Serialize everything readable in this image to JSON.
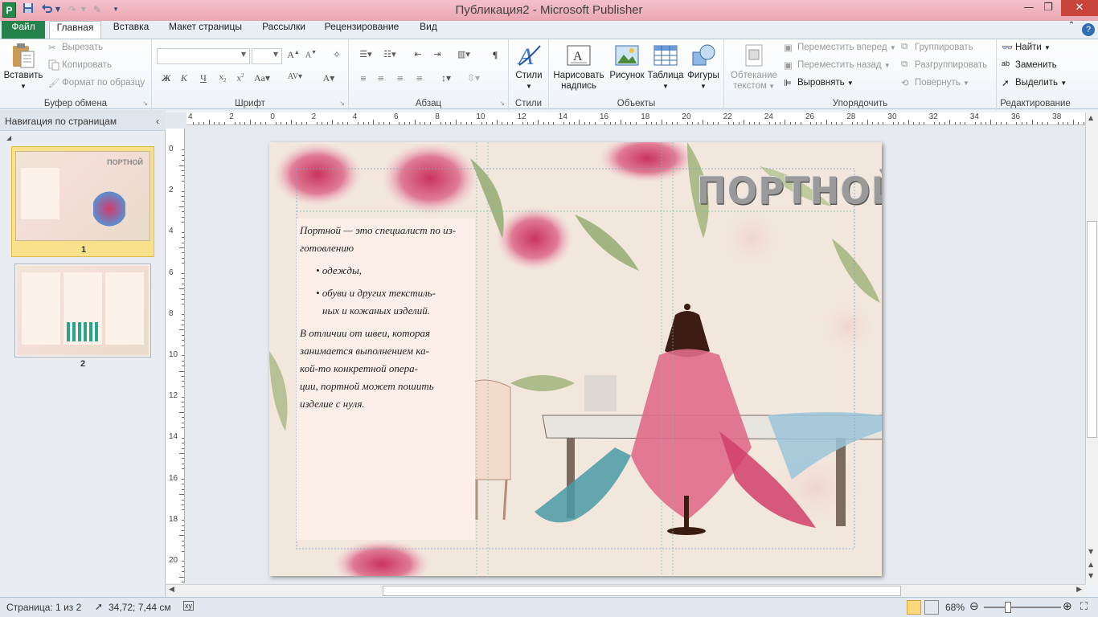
{
  "app": {
    "title": "Публикация2  -  Microsoft Publisher",
    "icon_letter": "P"
  },
  "quick_access": [
    "save-icon",
    "undo-icon",
    "redo-icon",
    "format-painter-icon",
    "customize-icon"
  ],
  "tabs": {
    "file": "Файл",
    "items": [
      "Главная",
      "Вставка",
      "Макет страницы",
      "Рассылки",
      "Рецензирование",
      "Вид"
    ]
  },
  "ribbon": {
    "clipboard": {
      "label": "Буфер обмена",
      "paste": "Вставить",
      "cut": "Вырезать",
      "copy": "Копировать",
      "format_painter": "Формат по образцу"
    },
    "font": {
      "label": "Шрифт"
    },
    "paragraph": {
      "label": "Абзац"
    },
    "styles": {
      "label": "Стили",
      "button": "Стили"
    },
    "objects": {
      "label": "Объекты",
      "draw_textbox": "Нарисовать надпись",
      "picture": "Рисунок",
      "table": "Таблица",
      "shapes": "Фигуры"
    },
    "arrange": {
      "label": "Упорядочить",
      "wrap_text": "Обтекание текстом",
      "bring_forward": "Переместить вперед",
      "send_backward": "Переместить назад",
      "align": "Выровнять",
      "group": "Группировать",
      "ungroup": "Разгруппировать",
      "rotate": "Повернуть"
    },
    "editing": {
      "label": "Редактирование",
      "find": "Найти",
      "replace": "Заменить",
      "select": "Выделить"
    }
  },
  "nav_pane": {
    "title": "Навигация по страницам",
    "pages": [
      "1",
      "2"
    ]
  },
  "ruler": {
    "h_labels": [
      "4",
      "2",
      "0",
      "2",
      "4",
      "6",
      "8",
      "10",
      "12",
      "14",
      "16",
      "18",
      "20",
      "22",
      "24",
      "26",
      "28",
      "30",
      "32",
      "34",
      "36",
      "38"
    ],
    "v_labels": [
      "0",
      "2",
      "4",
      "6",
      "8",
      "10",
      "12",
      "14",
      "16",
      "18",
      "20"
    ]
  },
  "document": {
    "heading": "ПОРТНОЙ",
    "intro": "Портной — это специалист по из-готовлению",
    "intro_1": "Портной — это специалист по из-",
    "intro_2": "готовлению",
    "bullets": [
      "одежды,",
      "обуви и других текстиль-",
      "ных и кожаных изделий."
    ],
    "body_lines": [
      "В отличии от швеи, которая",
      "занимается выполнением ка-",
      "кой-то конкретной опера-",
      "ции, портной может пошить",
      "изделие с нуля."
    ]
  },
  "status": {
    "page": "Страница: 1 из 2",
    "position": "34,72; 7,44 см",
    "zoom": "68%",
    "zoom_fraction": 0.68
  },
  "colors": {
    "file_tab": "#24824a",
    "title_bar": "#eaa7b2",
    "selected_thumb": "#f1d66a"
  }
}
